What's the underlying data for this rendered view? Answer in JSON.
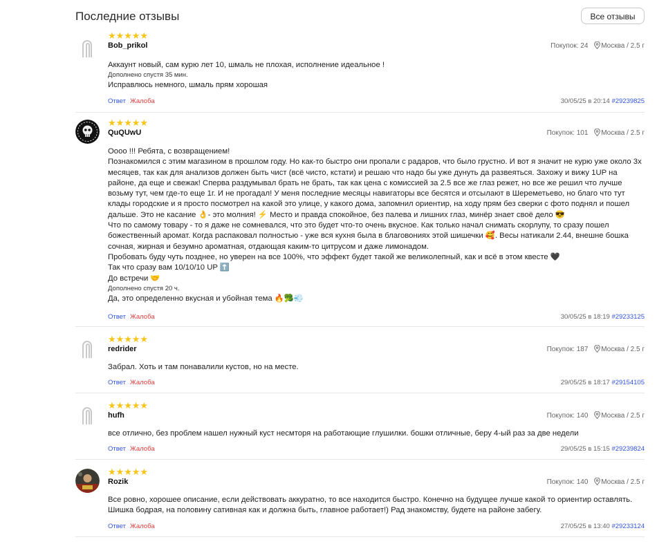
{
  "header": {
    "title": "Последние отзывы",
    "all_reviews_button": "Все отзывы"
  },
  "colors": {
    "star": "#f5c518",
    "link": "#3355dd",
    "complaint": "#e23b3b"
  },
  "common": {
    "purchases_label": "Покупок:",
    "location": "Москва / 2.5 г",
    "reply_label": "Ответ",
    "complaint_label": "Жалоба",
    "added_later_prefix": "Дополнено спустя",
    "rating": 5
  },
  "reviews": [
    {
      "username": "Bob_prikol",
      "purchases": "24",
      "avatar": "placeholder-icon",
      "text": [
        "Аккаунт новый, сам курю лет 10, шмаль не плохая, исполнение идеальное !"
      ],
      "addon_time": "35 мин.",
      "addon_text": [
        "Исправлюсь немного, шмаль прям хорошая"
      ],
      "date": "30/05/25 в 20:14",
      "order_id": "#29239825"
    },
    {
      "username": "QuQUwU",
      "purchases": "101",
      "avatar": "skull-avatar",
      "text": [
        "Оооо !!! Ребята, с возвращением!",
        "Познакомился с этим магазином в прошлом году. Но как-то быстро они пропали с радаров, что было грустно. И вот я значит не курю уже около 3х месяцев, так как для анализов должен быть чист (всё чисто, кстати) и решаю что надо бы уже дунуть да развеяться. Захожу и вижу 1UP на районе, да еще и свежак! Сперва раздумывал брать не брать, так как цена с комиссией за 2.5 все же глаз режет, но все же решил что лучше возьму тут, чем где-то еще 1г. И не прогадал! У меня последние месяцы навигаторы все бесятся и отсылают в Шереметьево, но благо что тут клады городские и я просто посмотрел на какой это улице, у какого дома, запомнил ориентир, на ходу прям без сверки с фото поднял и пошел дальше. Это не касание 👌- это молния! ⚡ Место и правда спокойное, без палева и лишних глаз, минёр знает своё дело 😎",
        "Что по самому товару - то я даже не сомневался, что это будет что-то очень вкусное. Как только начал снимать скорлупу, то сразу пошел божественный аромат. Когда распаковал полностью - уже вся кухня была в благовониях этой шишечки 🥰. Весы натикали 2.44, внешне бошка сочная, жирная и безумно ароматная, отдающая каким-то цитрусом и даже лимонадом.",
        "Пробовать буду чуть позднее, но уверен на все 100%, что эффект будет такой же великолепный, как и всё в этом квесте 🖤",
        "Так что сразу вам 10/10/10 UP ⬆️",
        "До встречи 🤝"
      ],
      "addon_time": "20 ч.",
      "addon_text": [
        "Да, это определенно вкусная и убойная тема 🔥🥦💨"
      ],
      "date": "30/05/25 в 18:19",
      "order_id": "#29233125"
    },
    {
      "username": "redrider",
      "purchases": "187",
      "avatar": "placeholder-icon",
      "text": [
        "Забрал. Хоть и там понавалили кустов, но на месте."
      ],
      "date": "29/05/25 в 18:17",
      "order_id": "#29154105"
    },
    {
      "username": "hufh",
      "purchases": "140",
      "avatar": "placeholder-icon",
      "text": [
        "все отлично, без проблем нашел нужный куст несмторя на работающие глушилки. бошки отличные, беру 4-ый раз за две недели"
      ],
      "date": "29/05/25 в 15:15",
      "order_id": "#29239824"
    },
    {
      "username": "Rozik",
      "purchases": "140",
      "avatar": "photo-avatar",
      "text": [
        "Все ровно, хорошее описание, если действовать аккуратно, то все находится быстро. Конечно на будущее лучше какой то ориентир оставлять. Шишка бодрая, на половину сативная как и должна быть, главное работает!) Рад знакомству, будете на районе забегу."
      ],
      "date": "27/05/25 в 13:40",
      "order_id": "#29233124"
    }
  ]
}
